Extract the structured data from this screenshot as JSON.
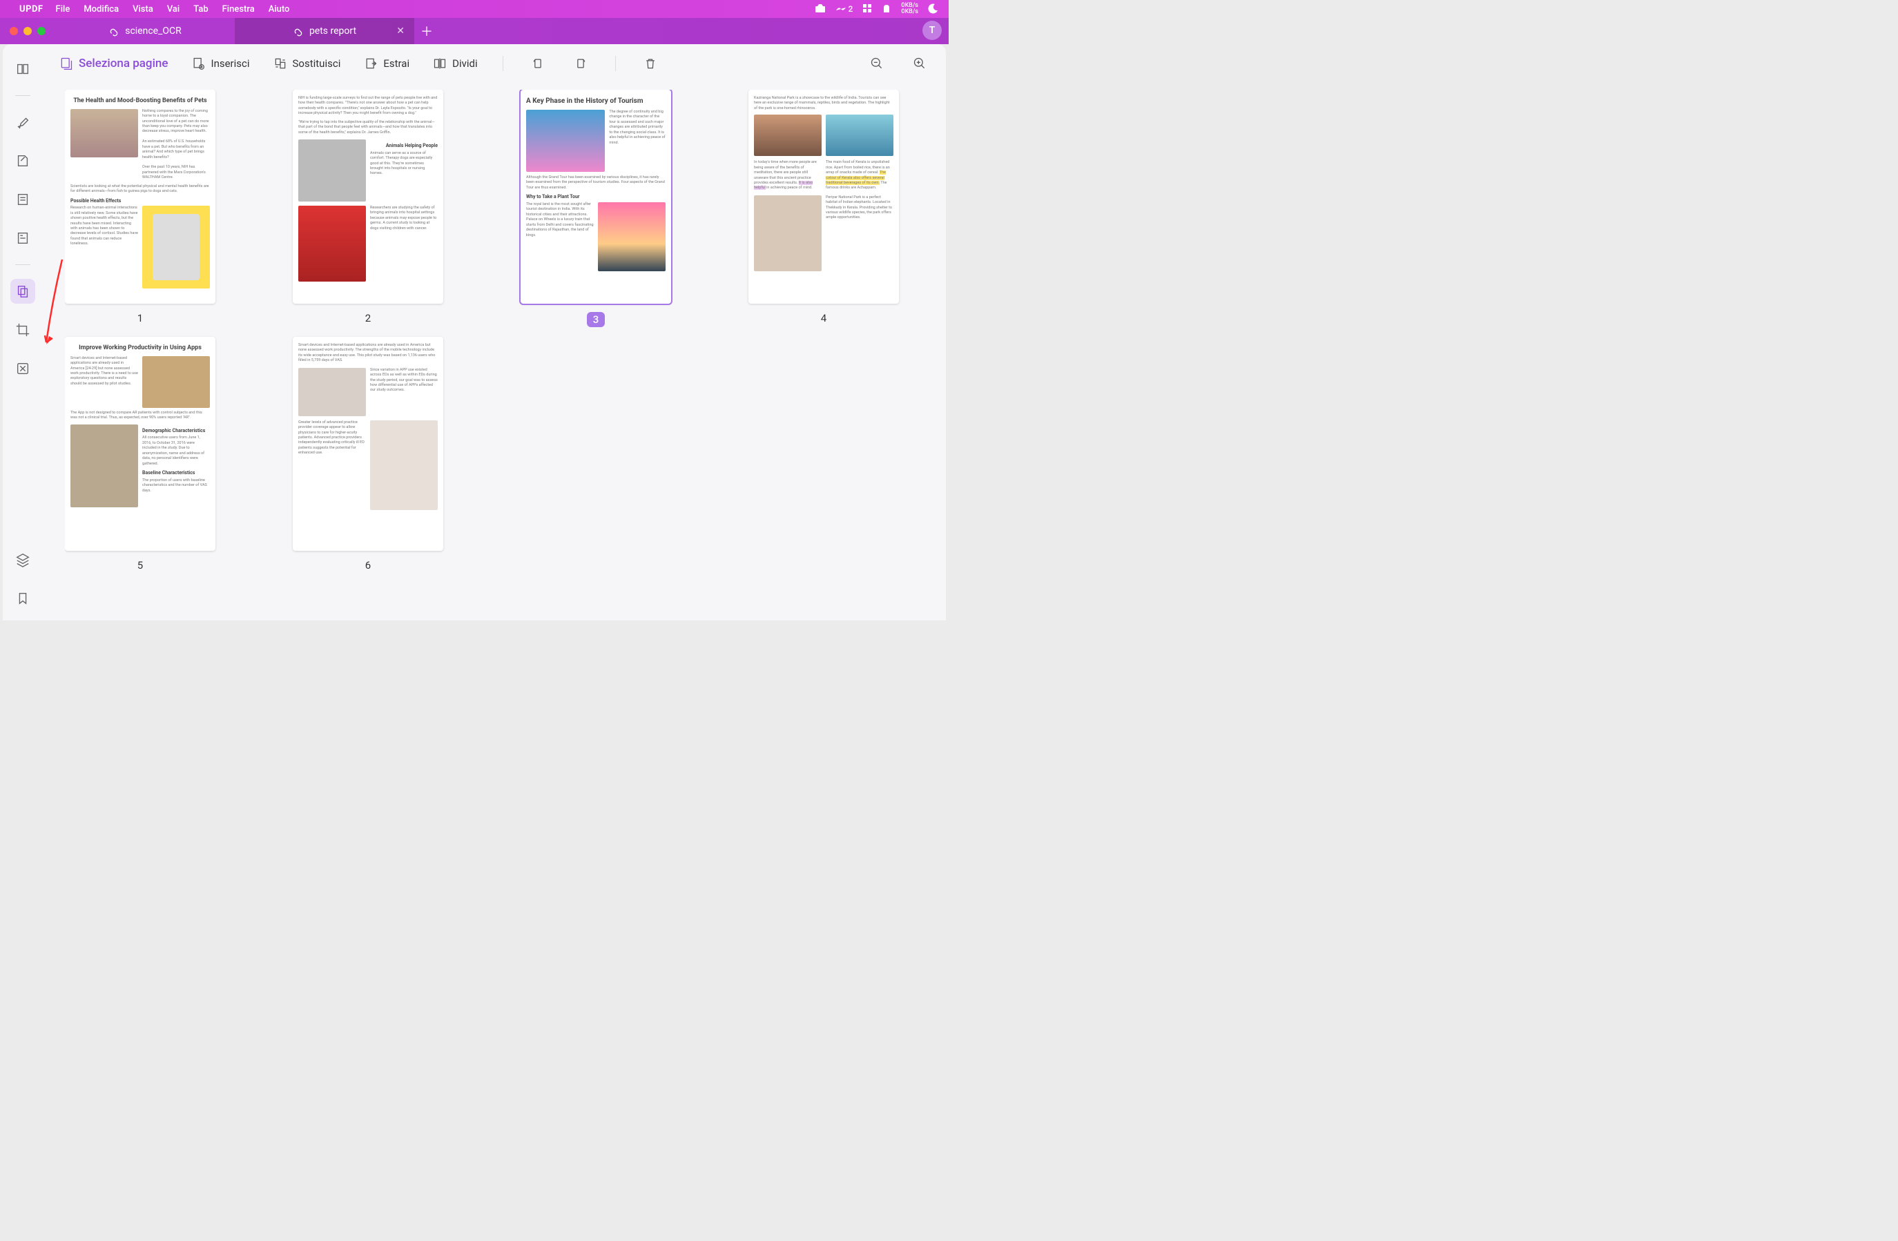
{
  "menubar": {
    "app": "UPDF",
    "items": [
      "File",
      "Modifica",
      "Vista",
      "Vai",
      "Tab",
      "Finestra",
      "Aiuto"
    ],
    "net_up": "0KB/s",
    "net_dn": "0KB/s",
    "count": "2"
  },
  "tabs": {
    "t1": "science_OCR",
    "t2": "pets report"
  },
  "avatar": "T",
  "toolbar": {
    "select": "Seleziona pagine",
    "insert": "Inserisci",
    "replace": "Sostituisci",
    "extract": "Estrai",
    "split": "Dividi"
  },
  "pages": {
    "p1": {
      "num": "1",
      "title": "The Health and Mood-Boosting Benefits of Pets",
      "h1": "Possible Health Effects"
    },
    "p2": {
      "num": "2",
      "h1": "Animals Helping People"
    },
    "p3": {
      "num": "3",
      "title": "A Key Phase in the History of Tourism",
      "h1": "Why to Take a Plant Tour"
    },
    "p4": {
      "num": "4"
    },
    "p5": {
      "num": "5",
      "title": "Improve Working Productivity in Using Apps",
      "h1": "Demographic Characteristics",
      "h2": "Baseline Characteristics"
    },
    "p6": {
      "num": "6"
    }
  }
}
